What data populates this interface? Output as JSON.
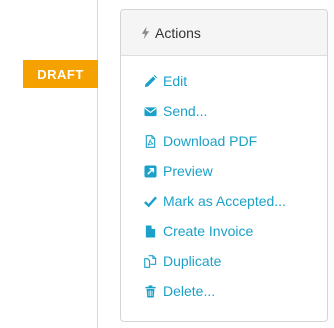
{
  "document": {
    "status_badge": "DRAFT"
  },
  "actions": {
    "title": "Actions",
    "items": [
      {
        "label": "Edit",
        "icon": "pencil-icon"
      },
      {
        "label": "Send...",
        "icon": "envelope-icon"
      },
      {
        "label": "Download PDF",
        "icon": "pdf-file-icon"
      },
      {
        "label": "Preview",
        "icon": "external-link-icon"
      },
      {
        "label": "Mark as Accepted...",
        "icon": "checkmark-icon"
      },
      {
        "label": "Create Invoice",
        "icon": "file-icon"
      },
      {
        "label": "Duplicate",
        "icon": "copy-icon"
      },
      {
        "label": "Delete...",
        "icon": "trash-icon"
      }
    ]
  },
  "colors": {
    "link": "#1ba1c9",
    "badge": "#f5a100",
    "header_bg": "#f5f5f5"
  }
}
